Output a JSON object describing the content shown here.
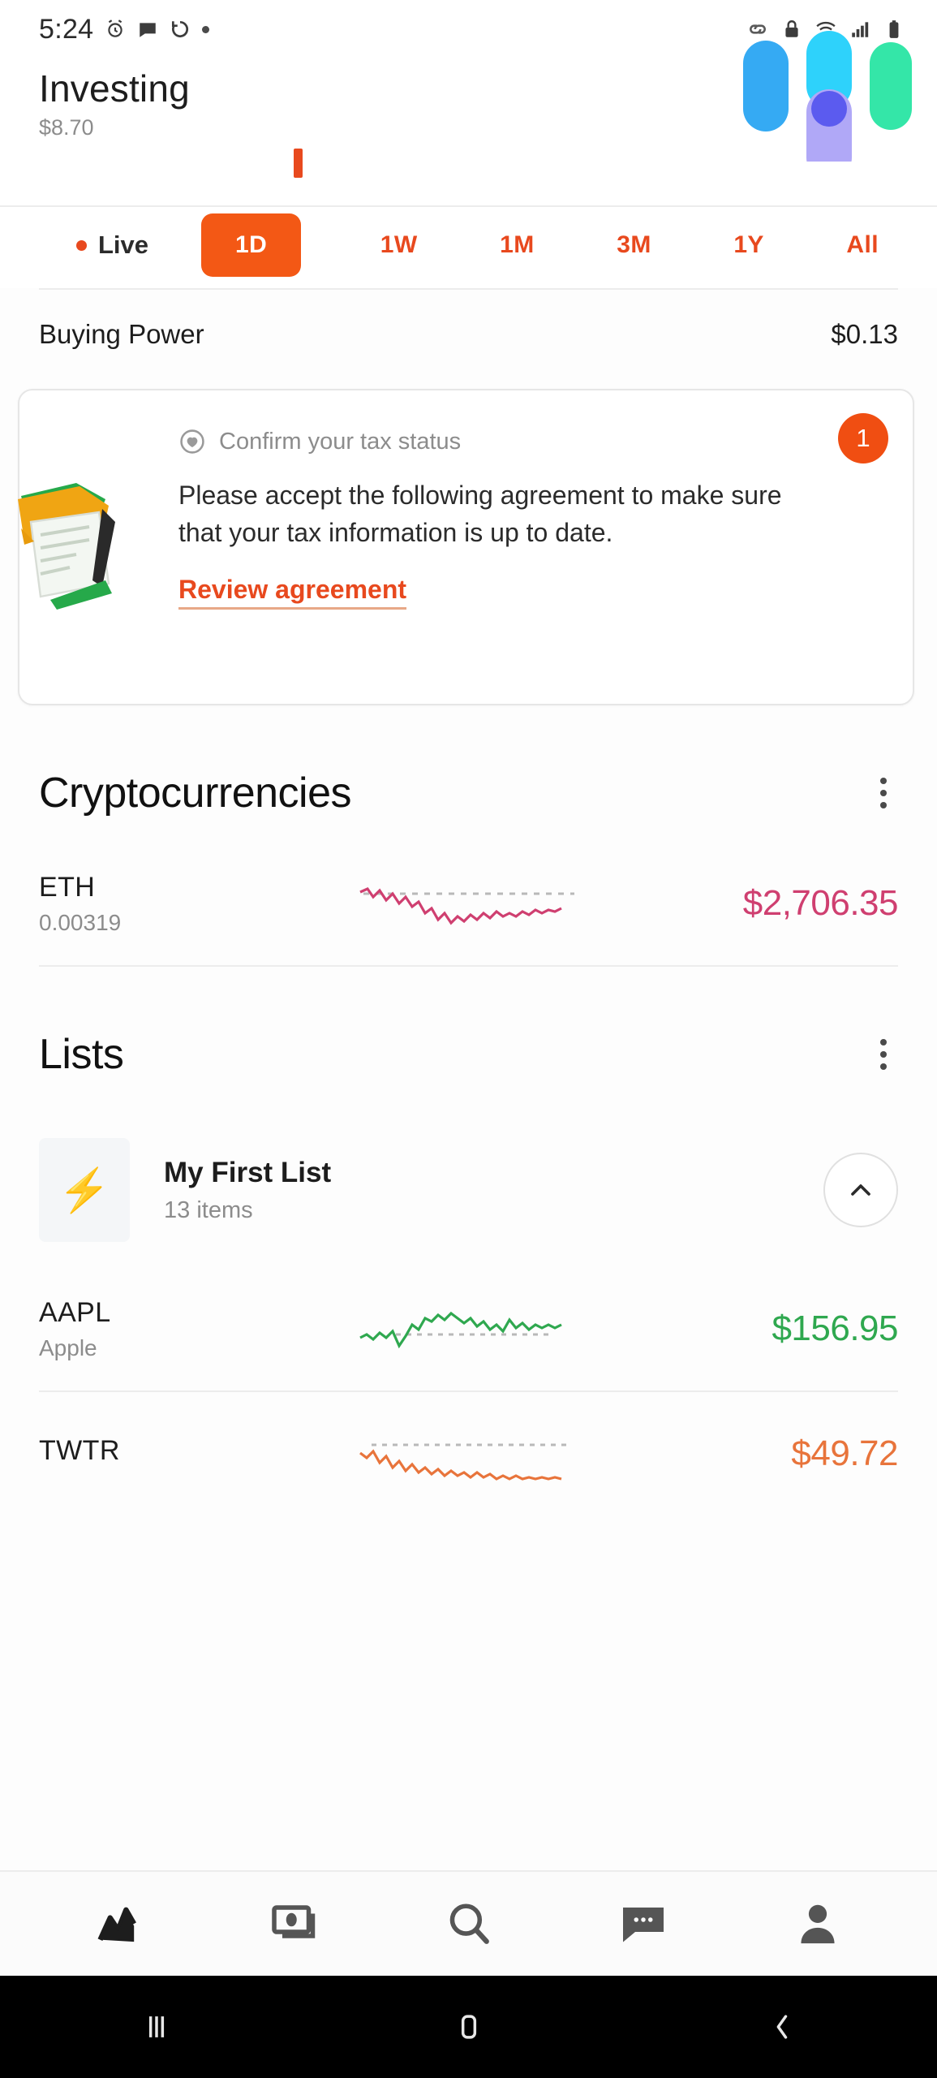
{
  "status_bar": {
    "time": "5:24",
    "left_icons": [
      "alarm-icon",
      "message-icon",
      "sync-icon",
      "dot-icon"
    ],
    "right_icons": [
      "link-icon",
      "lock-icon",
      "wifi-icon",
      "signal-icon",
      "battery-icon"
    ]
  },
  "header": {
    "title": "Investing",
    "subtitle": "$8.70"
  },
  "ranges": {
    "live_label": "Live",
    "options": [
      {
        "label": "1D",
        "selected": true
      },
      {
        "label": "1W",
        "selected": false
      },
      {
        "label": "1M",
        "selected": false
      },
      {
        "label": "3M",
        "selected": false
      },
      {
        "label": "1Y",
        "selected": false
      },
      {
        "label": "All",
        "selected": false
      }
    ]
  },
  "buying_power": {
    "label": "Buying Power",
    "value": "$0.13"
  },
  "notice_card": {
    "heading": "Confirm your tax status",
    "body": "Please accept the following agreement to make sure that your tax information is up to date.",
    "link_label": "Review agreement",
    "badge_count": "1",
    "illustration": "folder-documents-pencil-illustration"
  },
  "crypto_section": {
    "title": "Cryptocurrencies",
    "rows": [
      {
        "symbol": "ETH",
        "quantity": "0.00319",
        "price": "$2,706.35",
        "trend": "down",
        "color": "#cf3f70"
      }
    ]
  },
  "lists_section": {
    "title": "Lists",
    "list": {
      "name": "My First List",
      "count": "13 items",
      "icon": "lightning-bolt-icon",
      "expanded": true
    },
    "rows": [
      {
        "symbol": "AAPL",
        "name": "Apple",
        "price": "$156.95",
        "trend": "up",
        "color": "#2fa84f"
      },
      {
        "symbol": "TWTR",
        "name": "",
        "price": "$49.72",
        "trend": "down",
        "color": "#e8743b"
      }
    ]
  },
  "bottom_nav": {
    "items": [
      {
        "icon": "chart-line-icon",
        "active": true
      },
      {
        "icon": "banknote-icon",
        "active": false
      },
      {
        "icon": "search-icon",
        "active": false
      },
      {
        "icon": "chat-bubble-icon",
        "active": false
      },
      {
        "icon": "person-icon",
        "active": false
      }
    ]
  },
  "system_nav": {
    "items": [
      "recents-icon",
      "home-icon",
      "back-icon"
    ]
  },
  "colors": {
    "accent": "#e8491e",
    "accent_fill": "#f35815",
    "positive": "#2fa84f",
    "negative": "#cf3f70",
    "muted": "#8c8c8c"
  },
  "chart_data": {
    "type": "line",
    "title": "ETH sparkline",
    "series": [
      {
        "name": "ETH",
        "color": "#cf3f70",
        "trend": "down",
        "values": [
          52,
          46,
          58,
          40,
          50,
          34,
          42,
          30,
          36,
          22,
          26,
          16,
          20,
          12,
          24,
          14,
          22,
          16,
          26,
          18,
          24,
          20,
          26,
          22,
          24,
          20,
          26,
          24,
          28,
          22
        ]
      },
      {
        "name": "AAPL",
        "color": "#2fa84f",
        "trend": "up",
        "values": [
          22,
          26,
          20,
          30,
          24,
          34,
          28,
          40,
          34,
          48,
          42,
          56,
          50,
          60,
          52,
          56,
          48,
          52,
          44,
          50,
          42,
          48,
          40,
          46,
          38,
          44,
          40,
          46,
          42,
          48
        ]
      },
      {
        "name": "TWTR",
        "color": "#e8743b",
        "trend": "down",
        "values": [
          46,
          40,
          50,
          34,
          44,
          28,
          36,
          22,
          30,
          18,
          24,
          14,
          20,
          12,
          18,
          10,
          16,
          12,
          18,
          10,
          14,
          8,
          12,
          8,
          10,
          6,
          8,
          6,
          8,
          4
        ]
      }
    ],
    "reference_line": "dashed-grey"
  }
}
